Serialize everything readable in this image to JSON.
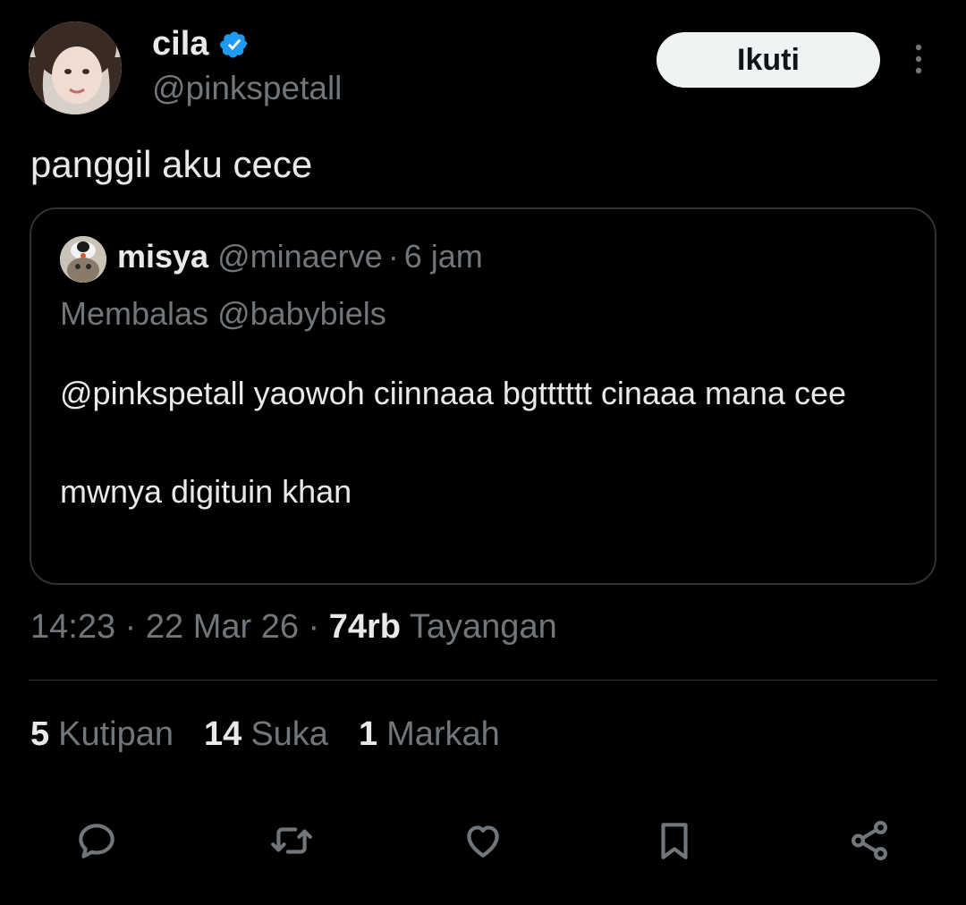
{
  "author": {
    "display_name": "cila",
    "handle": "@pinkspetall",
    "verified_icon": "verified-badge-icon",
    "avatar_icon": "avatar"
  },
  "follow_button_label": "Ikuti",
  "more_icon": "more-vertical-icon",
  "tweet_text": "panggil aku cece",
  "quoted": {
    "display_name": "misya",
    "handle": "@minaerve",
    "separator": "·",
    "time": "6 jam",
    "reply_to": "Membalas @babybiels",
    "body_line1": "@pinkspetall yaowoh ciinnaaa bgtttttt cinaaa mana cee",
    "body_line2": "mwnya digituin khan"
  },
  "meta": {
    "time": "14:23",
    "sep1": "·",
    "date": "22 Mar 26",
    "sep2": "·",
    "views_count": "74rb",
    "views_label": "Tayangan"
  },
  "stats": [
    {
      "count": "5",
      "label": "Kutipan"
    },
    {
      "count": "14",
      "label": "Suka"
    },
    {
      "count": "1",
      "label": "Markah"
    }
  ],
  "actions": [
    "reply-icon",
    "retweet-icon",
    "like-icon",
    "bookmark-icon",
    "share-icon"
  ],
  "colors": {
    "background": "#000000",
    "primary_text": "#e7e9ea",
    "secondary_text": "#71767b",
    "border": "#2f3336",
    "verified": "#1d9bf0",
    "follow_bg": "#eff3f4"
  }
}
